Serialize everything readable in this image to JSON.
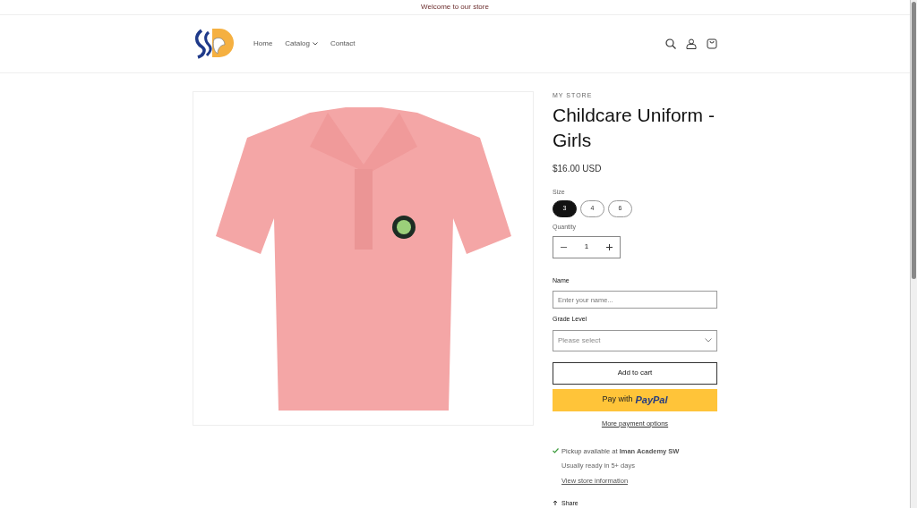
{
  "announcement": "Welcome to our store",
  "nav": [
    {
      "label": "Home",
      "has_menu": false
    },
    {
      "label": "Catalog",
      "has_menu": true
    },
    {
      "label": "Contact",
      "has_menu": false
    }
  ],
  "product": {
    "vendor": "MY STORE",
    "title": "Childcare Uniform - Girls",
    "price": "$16.00 USD",
    "size_label": "Size",
    "sizes": [
      {
        "label": "3",
        "selected": true
      },
      {
        "label": "4",
        "selected": false
      },
      {
        "label": "6",
        "selected": false
      }
    ],
    "quantity_label": "Quantity",
    "quantity": "1",
    "name_label": "Name",
    "name_placeholder": "Enter your name...",
    "grade_label": "Grade Level",
    "grade_placeholder": "Please select",
    "add_to_cart": "Add to cart",
    "paypal_prefix": "Pay with",
    "paypal_brand": "PayPal",
    "more_payment": "More payment options",
    "pickup": "Pickup available at **Iman Academy SW**",
    "pickup_time": "Usually ready in 5+ days",
    "store_info": "View store information",
    "share": "Share"
  }
}
